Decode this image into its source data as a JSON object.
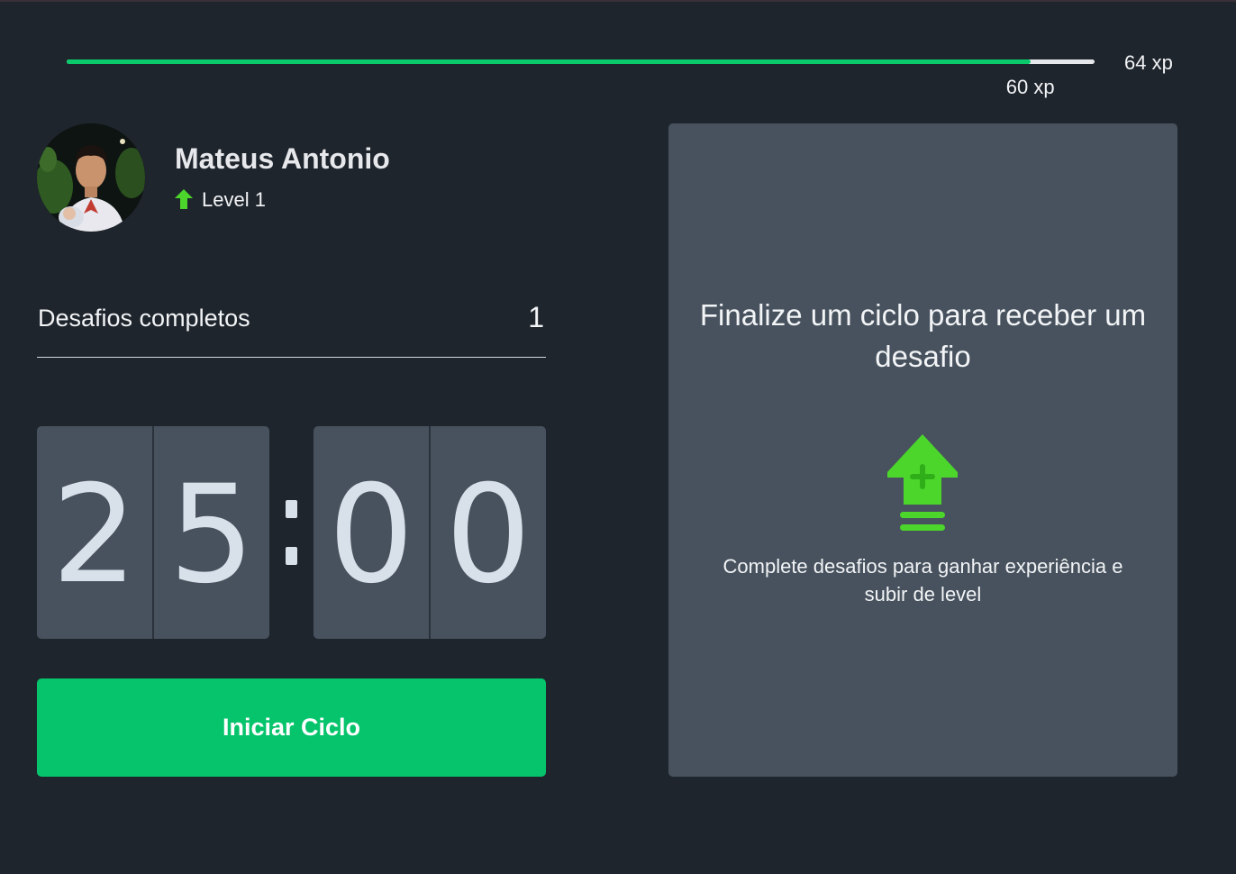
{
  "experience": {
    "current_label": "60 xp",
    "max_label": "64 xp",
    "progress_fraction": 0.9375
  },
  "profile": {
    "name": "Mateus Antonio",
    "level_label": "Level 1",
    "level_icon": "level-up-arrow-icon"
  },
  "completed_challenges": {
    "label": "Desafios completos",
    "value": "1"
  },
  "countdown": {
    "minute_left": "2",
    "minute_right": "5",
    "second_left": "0",
    "second_right": "0"
  },
  "start_button": {
    "label": "Iniciar Ciclo"
  },
  "challenge_box": {
    "title": "Finalize um ciclo para receber um desafio",
    "icon": "level-up-icon",
    "description": "Complete desafios para ganhar experiência e subir de level"
  },
  "colors": {
    "background": "#1f252d",
    "accent_green": "#05c46b",
    "icon_green": "#4cd62b",
    "panel": "#47525e"
  }
}
